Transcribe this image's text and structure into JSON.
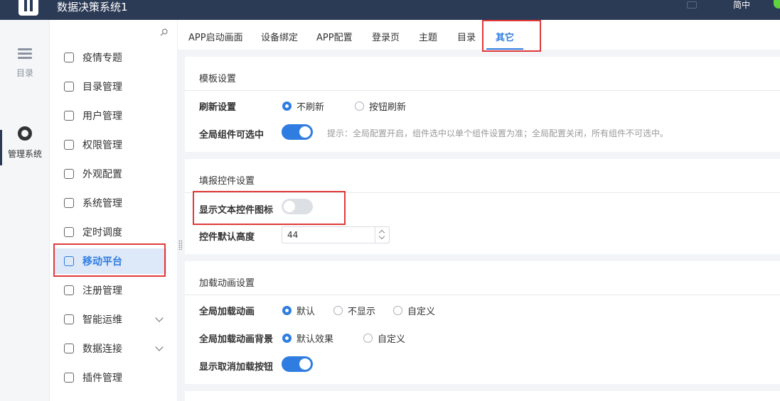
{
  "app": {
    "title": "数据决策系统1",
    "lang": "简中"
  },
  "rail": [
    {
      "label": "目录",
      "icon": "list-icon"
    },
    {
      "label": "管理系统",
      "icon": "gear-icon"
    }
  ],
  "menu": {
    "items": [
      {
        "label": "疫情专题",
        "icon": "report-icon"
      },
      {
        "label": "目录管理",
        "icon": "catalog-icon"
      },
      {
        "label": "用户管理",
        "icon": "user-icon"
      },
      {
        "label": "权限管理",
        "icon": "lock-icon"
      },
      {
        "label": "外观配置",
        "icon": "paint-icon"
      },
      {
        "label": "系统管理",
        "icon": "settings-icon"
      },
      {
        "label": "定时调度",
        "icon": "timer-icon"
      },
      {
        "label": "移动平台",
        "icon": "mobile-icon"
      },
      {
        "label": "注册管理",
        "icon": "register-icon"
      },
      {
        "label": "智能运维",
        "icon": "network-icon"
      },
      {
        "label": "数据连接",
        "icon": "link-icon"
      },
      {
        "label": "插件管理",
        "icon": "plugin-icon"
      }
    ]
  },
  "tabs": [
    "APP启动画面",
    "设备绑定",
    "APP配置",
    "登录页",
    "主题",
    "目录",
    "其它"
  ],
  "template_panel": {
    "title": "模板设置",
    "refresh_label": "刷新设置",
    "refresh_options": [
      "不刷新",
      "按钮刷新"
    ],
    "selectable_label": "全局组件可选中",
    "selectable_hint": "提示：全局配置开启，组件选中以单个组件设置为准；全局配置关闭，所有组件不可选中。"
  },
  "fill_panel": {
    "title": "填报控件设置",
    "show_icon_label": "显示文本控件图标",
    "height_label": "控件默认高度",
    "height_value": "44"
  },
  "loading_panel": {
    "title": "加载动画设置",
    "anim_label": "全局加载动画",
    "anim_options": [
      "默认",
      "不显示",
      "自定义"
    ],
    "bg_label": "全局加载动画背景",
    "bg_options": [
      "默认效果",
      "自定义"
    ],
    "cancel_label": "显示取消加载按钮"
  },
  "state": {
    "refresh_selected": "不刷新",
    "selectable_on": true,
    "show_icon_on": false,
    "anim_selected": "默认",
    "bg_selected": "默认效果",
    "cancel_on": true
  },
  "colors": {
    "accent": "#2f7de1",
    "topbar": "#2b3a55",
    "annotation": "#e03a3a"
  }
}
